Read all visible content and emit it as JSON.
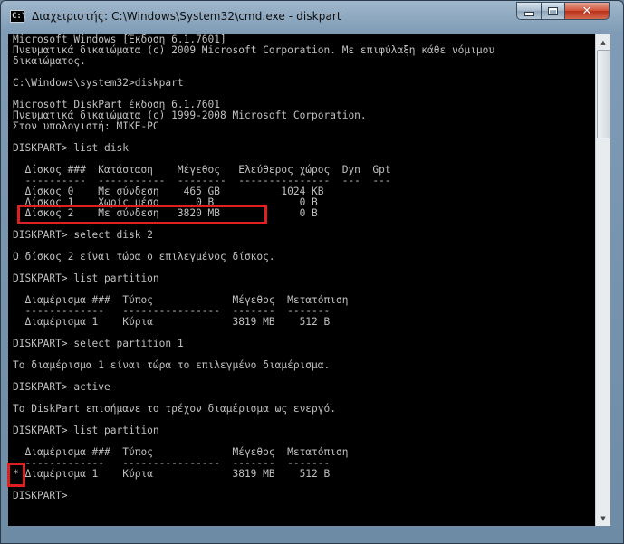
{
  "window": {
    "title": "Διαχειριστής: C:\\Windows\\System32\\cmd.exe - diskpart",
    "icon": "cmd-icon",
    "icon_glyph": "C:\\",
    "controls": {
      "minimize": "minimize-icon",
      "maximize": "maximize-icon",
      "close": "close-icon",
      "close_glyph": "✕"
    }
  },
  "console": {
    "lines": [
      "Microsoft Windows [Έκδοση 6.1.7601]",
      "Πνευματικά δικαιώματα (c) 2009 Microsoft Corporation. Με επιφύλαξη κάθε νόμιμου",
      "δικαιώματος.",
      "",
      "C:\\Windows\\system32>diskpart",
      "",
      "Microsoft DiskPart έκδοση 6.1.7601",
      "Πνευματικά δικαιώματα (c) 1999-2008 Microsoft Corporation.",
      "Στον υπολογιστή: MIKE-PC",
      "",
      "DISKPART> list disk",
      "",
      "  Δίσκος ###  Κατάσταση    Μέγεθος   Ελεύθερος χώρος  Dyn  Gpt",
      "  ----------  -----------  --------  ---------------  ---  ---",
      "  Δίσκος 0    Με σύνδεση    465 GB          1024 KB",
      "  Δίσκος 1    Χωρίς μέσο      0 B              0 B",
      "  Δίσκος 2    Με σύνδεση   3820 MB             0 B",
      "",
      "DISKPART> select disk 2",
      "",
      "Ο δίσκος 2 είναι τώρα ο επιλεγμένος δίσκος.",
      "",
      "DISKPART> list partition",
      "",
      "  Διαμέρισμα ###  Τύπος             Μέγεθος  Μετατόπιση",
      "  -------------   ----------------  -------  -------",
      "  Διαμέρισμα 1    Κύρια             3819 MB    512 B",
      "",
      "DISKPART> select partition 1",
      "",
      "Το διαμέρισμα 1 είναι τώρα το επιλεγμένο διαμέρισμα.",
      "",
      "DISKPART> active",
      "",
      "Το DiskPart επισήμανε το τρέχον διαμέρισμα ως ενεργό.",
      "",
      "DISKPART> list partition",
      "",
      "  Διαμέρισμα ###  Τύπος             Μέγεθος  Μετατόπιση",
      "  -------------   ----------------  -------  -------",
      "* Διαμέρισμα 1    Κύρια             3819 MB    512 B",
      "",
      "DISKPART>"
    ]
  },
  "annotations": {
    "highlight_color": "#e02020",
    "highlighted_disk_row": "Δίσκος 2",
    "highlighted_marker": "*"
  },
  "colors": {
    "console_bg": "#000000",
    "console_text": "#c0c0c0",
    "close_button": "#c8452e"
  }
}
